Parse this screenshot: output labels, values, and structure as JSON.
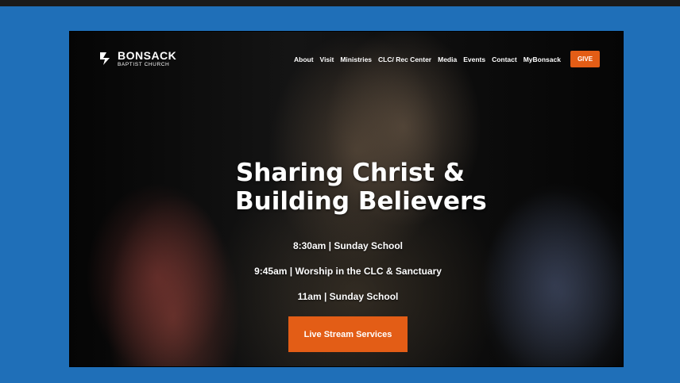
{
  "header": {
    "logo": {
      "name": "BONSACK",
      "sub": "BAPTIST CHURCH",
      "icon": "church-logo-icon"
    },
    "nav": [
      "About",
      "Visit",
      "Ministries",
      "CLC/ Rec Center",
      "Media",
      "Events",
      "Contact",
      "MyBonsack"
    ],
    "give_label": "GIVE"
  },
  "hero": {
    "headline_line1": "Sharing Christ &",
    "headline_line2": "Building Believers",
    "schedule": [
      "8:30am | Sunday School",
      "9:45am | Worship in the CLC & Sanctuary",
      "11am | Sunday School"
    ],
    "cta_label": "Live Stream Services"
  },
  "colors": {
    "page_bg": "#1f6fb8",
    "accent": "#e35d16",
    "text": "#ffffff"
  }
}
